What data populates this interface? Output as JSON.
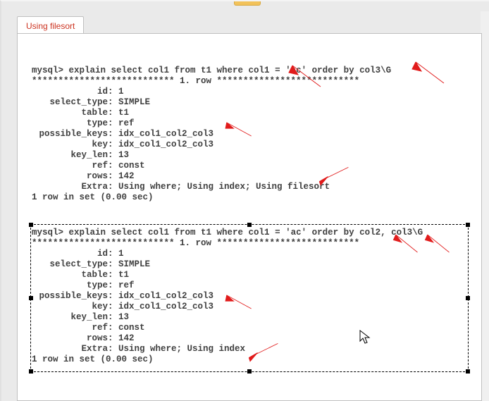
{
  "tab": {
    "label": "Using filesort"
  },
  "block1": {
    "prompt": "mysql> ",
    "query": "explain select col1 from t1 where col1 = 'ac' order by col3\\G",
    "row_sep": "*************************** 1. row ***************************",
    "id_label": "id",
    "id": "1",
    "select_type_label": "select_type",
    "select_type": "SIMPLE",
    "table_label": "table",
    "table": "t1",
    "type_label": "type",
    "type": "ref",
    "possible_keys_label": "possible_keys",
    "possible_keys": "idx_col1_col2_col3",
    "key_label": "key",
    "key": "idx_col1_col2_col3",
    "key_len_label": "key_len",
    "key_len": "13",
    "ref_label": "ref",
    "ref": "const",
    "rows_label": "rows",
    "rows": "142",
    "extra_label": "Extra",
    "extra": "Using where; Using index; Using filesort",
    "footer": "1 row in set (0.00 sec)"
  },
  "block2": {
    "prompt": "mysql> ",
    "query": "explain select col1 from t1 where col1 = 'ac' order by col2, col3\\G",
    "row_sep": "*************************** 1. row ***************************",
    "id_label": "id",
    "id": "1",
    "select_type_label": "select_type",
    "select_type": "SIMPLE",
    "table_label": "table",
    "table": "t1",
    "type_label": "type",
    "type": "ref",
    "possible_keys_label": "possible_keys",
    "possible_keys": "idx_col1_col2_col3",
    "key_label": "key",
    "key": "idx_col1_col2_col3",
    "key_len_label": "key_len",
    "key_len": "13",
    "ref_label": "ref",
    "ref": "const",
    "rows_label": "rows",
    "rows": "142",
    "extra_label": "Extra",
    "extra": "Using where; Using index",
    "footer": "1 row in set (0.00 sec)"
  },
  "annotations": {
    "arrow_color": "#e11b1b"
  }
}
